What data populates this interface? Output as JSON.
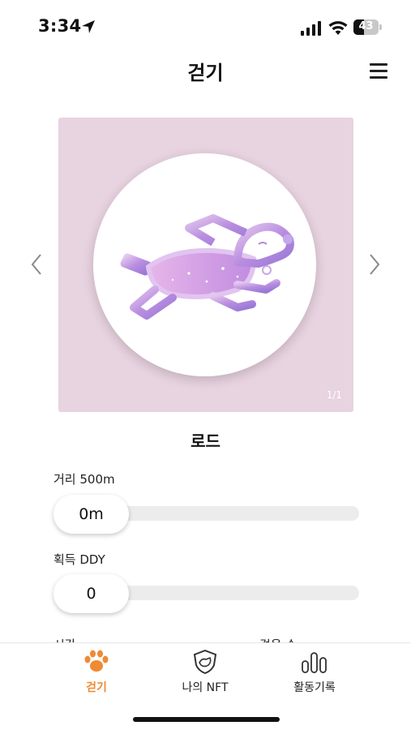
{
  "status_bar": {
    "time": "3:34",
    "battery": "43",
    "battery_level": 0.43,
    "icons": [
      "location-arrow-icon",
      "signal-icon",
      "wifi-icon",
      "battery-icon"
    ]
  },
  "header": {
    "title": "걷기",
    "menu_icon": "hamburger-menu-icon"
  },
  "carousel": {
    "prev_icon": "chevron-left-icon",
    "next_icon": "chevron-right-icon",
    "page_indicator": "1/1",
    "nft_name": "로드",
    "background_color": "#e8d3e0"
  },
  "distance": {
    "label": "거리 500m",
    "value": "0m",
    "progress": 0
  },
  "ddy": {
    "label": "획득 DDY",
    "value": "0",
    "progress": 0
  },
  "partial_row": {
    "left_label": "시간",
    "right_label": "걸음 수"
  },
  "tab_bar": {
    "active_color": "#f08a33",
    "tabs": [
      {
        "label": "걷기",
        "icon": "paw-icon",
        "active": true
      },
      {
        "label": "나의 NFT",
        "icon": "nft-shield-icon",
        "active": false
      },
      {
        "label": "활동기록",
        "icon": "bar-chart-icon",
        "active": false
      }
    ]
  }
}
